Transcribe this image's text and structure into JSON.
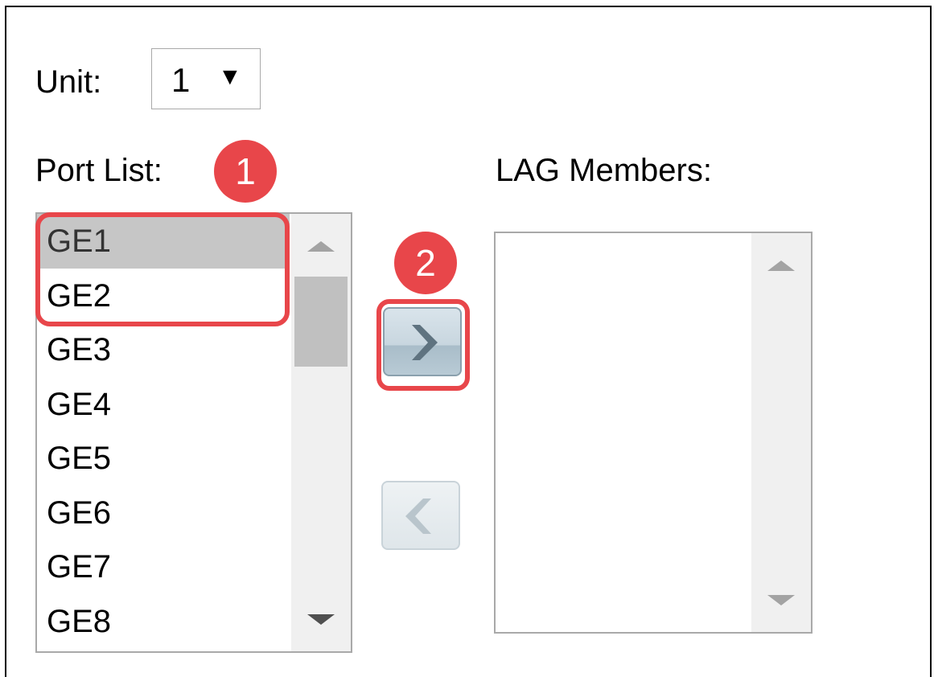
{
  "unit": {
    "label": "Unit:",
    "value": "1",
    "caret": "▼"
  },
  "port_list": {
    "label": "Port List:",
    "items": [
      "GE1",
      "GE2",
      "GE3",
      "GE4",
      "GE5",
      "GE6",
      "GE7",
      "GE8"
    ],
    "selected": [
      "GE1"
    ]
  },
  "lag_members": {
    "label": "LAG Members:",
    "items": []
  },
  "buttons": {
    "add_icon": "chevron-right-icon",
    "remove_icon": "chevron-left-icon"
  },
  "callouts": {
    "step1": "1",
    "step2": "2",
    "color": "#e8464a"
  }
}
